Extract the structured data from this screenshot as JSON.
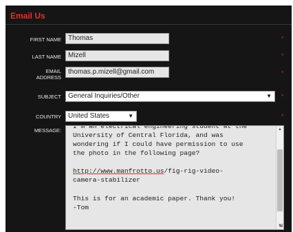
{
  "form": {
    "title": "Email Us",
    "required_marker": "*",
    "first_name": {
      "label": "FIRST NAME",
      "value": "Thomas"
    },
    "last_name": {
      "label": "LAST NAME",
      "value": "Mizell"
    },
    "email": {
      "label_line1": "EMAIL",
      "label_line2": "ADDRESS",
      "value": "thomas.p.mizell@gmail.com"
    },
    "subject": {
      "label": "SUBJECT",
      "selected": "General Inquiries/Other"
    },
    "country": {
      "label": "COUNTRY",
      "selected": "United States"
    },
    "message": {
      "label": "MESSAGE:",
      "line1": "I'm an electrical engineering student at the",
      "line2": "University of Central Florida, and was",
      "line3": "wondering if I could have permission to use",
      "line4": "the photo in the following page?",
      "line5_url_a": "http://www.manfrotto.us",
      "line5_url_b": "/fig-rig-video-",
      "line6": "camera-stabilizer",
      "line7": "This is for an academic paper. Thank you!",
      "line8": "-Tom"
    }
  },
  "icons": {
    "dropdown_arrow": "▼",
    "scroll_up": "▲",
    "scroll_down": "▼",
    "resize_grip": "◢"
  },
  "colors": {
    "panel_background": "#151515",
    "title": "#e8302a",
    "required": "#cc2222"
  }
}
